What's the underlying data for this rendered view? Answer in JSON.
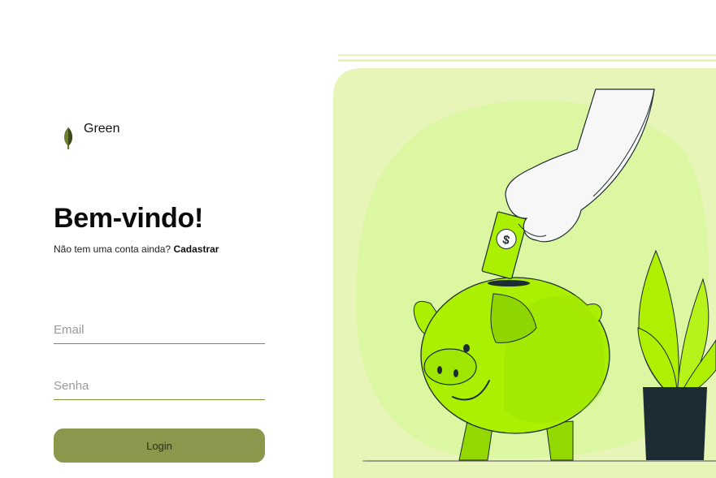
{
  "brand": {
    "name": "Green",
    "icon": "leaf-icon"
  },
  "welcome": {
    "title": "Bem-vindo!",
    "signup_prompt": "Não tem uma conta ainda?",
    "signup_link": "Cadastrar"
  },
  "form": {
    "email_placeholder": "Email",
    "password_placeholder": "Senha",
    "login_label": "Login"
  },
  "illustration": {
    "subject": "hand dropping dollar bill into green piggy bank beside potted plant"
  },
  "colors": {
    "accent": "#8a974d",
    "illustration_bg": "#e8f5b8",
    "pig": "#aaf000",
    "pot": "#1d2b33"
  }
}
